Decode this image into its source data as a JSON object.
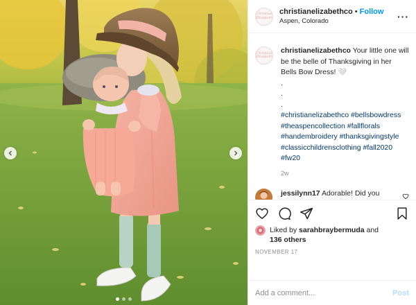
{
  "header": {
    "username": "christianelizabethco",
    "separator": "•",
    "follow_label": "Follow",
    "location": "Aspen, Colorado",
    "more_label": "···",
    "avatar_logo_text": "Christian Elizabeth"
  },
  "caption": {
    "username": "christianelizabethco",
    "text": "Your little one will be the belle of Thanksgiving in her Bells Bow Dress! 🤍",
    "dot_lines": [
      ".",
      ".",
      "."
    ],
    "hashtags": [
      "#christianelizabethco",
      "#bellsbowdress",
      "#theaspencollection",
      "#fallflorals",
      "#handembroidery",
      "#thanksgivingstyle",
      "#classicchildrensclothing",
      "#fall2020",
      "#fw20"
    ],
    "time": "2w"
  },
  "comment": {
    "username": "jessilynn17",
    "text": "Adorable! Did you make a dolly match that I somehow missed when I preordered this dress?"
  },
  "likes": {
    "prefix": "Liked by",
    "liker": "sarahbraybermuda",
    "and": "and",
    "others": "136 others"
  },
  "date": "NOVEMBER 17",
  "add_comment": {
    "placeholder": "Add a comment...",
    "post_label": "Post"
  },
  "carousel": {
    "slide_count": 3,
    "active_index": 0
  },
  "colors": {
    "link": "#0095f6",
    "hashtag": "#00376b",
    "muted": "#8e8e8e",
    "post_disabled": "#b2dffc"
  }
}
